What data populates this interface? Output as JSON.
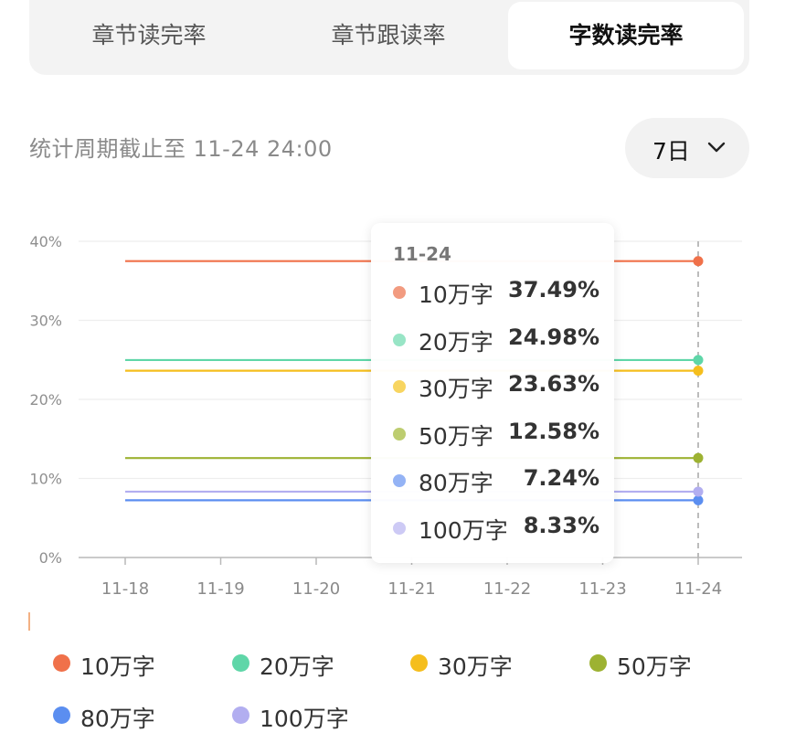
{
  "tabs": [
    {
      "label": "章节读完率",
      "active": false
    },
    {
      "label": "章节跟读率",
      "active": false
    },
    {
      "label": "字数读完率",
      "active": true
    }
  ],
  "period": {
    "label": "统计周期截止至 11-24 24:00",
    "selected": "7日"
  },
  "chart_data": {
    "type": "line",
    "x": [
      "11-18",
      "11-19",
      "11-20",
      "11-21",
      "11-22",
      "11-23",
      "11-24"
    ],
    "y_ticks": [
      "0%",
      "10%",
      "20%",
      "30%",
      "40%"
    ],
    "ylim": [
      0,
      40
    ],
    "grid": true,
    "legend_position": "bottom",
    "series": [
      {
        "name": "10万字",
        "color": "#f0714a",
        "values": [
          37.49,
          37.49,
          37.49,
          37.49,
          37.49,
          37.49,
          37.49
        ]
      },
      {
        "name": "20万字",
        "color": "#5fd6a8",
        "values": [
          24.98,
          24.98,
          24.98,
          24.98,
          24.98,
          24.98,
          24.98
        ]
      },
      {
        "name": "30万字",
        "color": "#f5be1d",
        "values": [
          23.63,
          23.63,
          23.63,
          23.63,
          23.63,
          23.63,
          23.63
        ]
      },
      {
        "name": "50万字",
        "color": "#9db232",
        "values": [
          12.58,
          12.58,
          12.58,
          12.58,
          12.58,
          12.58,
          12.58
        ]
      },
      {
        "name": "80万字",
        "color": "#5b8ef0",
        "values": [
          7.24,
          7.24,
          7.24,
          7.24,
          7.24,
          7.24,
          7.24
        ]
      },
      {
        "name": "100万字",
        "color": "#b2aef0",
        "values": [
          8.33,
          8.33,
          8.33,
          8.33,
          8.33,
          8.33,
          8.33
        ]
      }
    ],
    "tooltip": {
      "date": "11-24",
      "rows": [
        {
          "name": "10万字",
          "value": "37.49%",
          "color": "#f29b80"
        },
        {
          "name": "20万字",
          "value": "24.98%",
          "color": "#98e5c6"
        },
        {
          "name": "30万字",
          "value": "23.63%",
          "color": "#f8d560"
        },
        {
          "name": "50万字",
          "value": "12.58%",
          "color": "#bdcd70"
        },
        {
          "name": "80万字",
          "value": "7.24%",
          "color": "#94b3f5"
        },
        {
          "name": "100万字",
          "value": "8.33%",
          "color": "#cdcaf5"
        }
      ]
    }
  }
}
